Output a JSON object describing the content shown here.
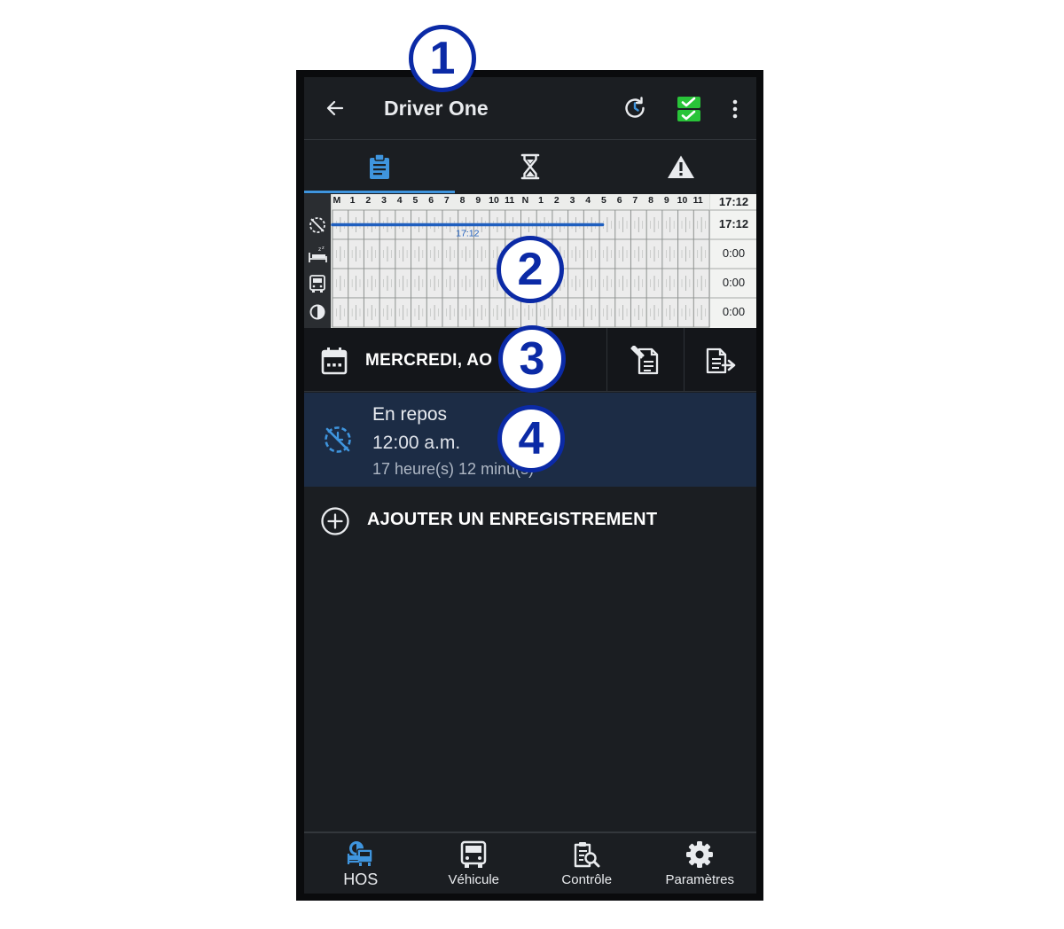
{
  "header": {
    "title": "Driver One",
    "back_icon": "arrow-left-icon",
    "sync_icon": "sync-clock-icon",
    "status_icon": "checklist-icon",
    "status_color": "#29c439",
    "menu_icon": "more-vertical-icon"
  },
  "tabs": [
    {
      "icon": "clipboard-icon",
      "active": true
    },
    {
      "icon": "hourglass-icon",
      "active": false
    },
    {
      "icon": "warning-icon",
      "active": false
    }
  ],
  "log_grid": {
    "hour_labels": [
      "M",
      "1",
      "2",
      "3",
      "4",
      "5",
      "6",
      "7",
      "8",
      "9",
      "10",
      "11",
      "N",
      "1",
      "2",
      "3",
      "4",
      "5",
      "6",
      "7",
      "8",
      "9",
      "10",
      "11"
    ],
    "header_total": "17:12",
    "rows": [
      {
        "status_icon": "off-duty-icon",
        "total": "17:12"
      },
      {
        "status_icon": "sleeper-berth-icon",
        "total": "0:00"
      },
      {
        "status_icon": "driving-icon",
        "total": "0:00"
      },
      {
        "status_icon": "on-duty-icon",
        "total": "0:00"
      }
    ],
    "segment": {
      "row": 0,
      "start_hour": 0,
      "end_hour": 17.2,
      "label": "17:12",
      "color": "#1f5fbf"
    }
  },
  "date_bar": {
    "icon": "calendar-icon",
    "label": "MERCREDI, AO",
    "edit_icon": "edit-document-icon",
    "export_icon": "export-document-icon"
  },
  "log_entry": {
    "icon": "off-duty-icon",
    "status": "En repos",
    "time": "12:00 a.m.",
    "duration": "17 heure(s) 12 minu(s)"
  },
  "add_record": {
    "icon": "plus-circle-icon",
    "label": "AJOUTER UN ENREGISTREMENT"
  },
  "bottom_nav": [
    {
      "label": "HOS",
      "icon": "hos-icon",
      "active": true
    },
    {
      "label": "Véhicule",
      "icon": "truck-icon",
      "active": false
    },
    {
      "label": "Contrôle",
      "icon": "inspection-icon",
      "active": false
    },
    {
      "label": "Paramètres",
      "icon": "gear-icon",
      "active": false
    }
  ],
  "callouts": [
    "1",
    "2",
    "3",
    "4"
  ]
}
